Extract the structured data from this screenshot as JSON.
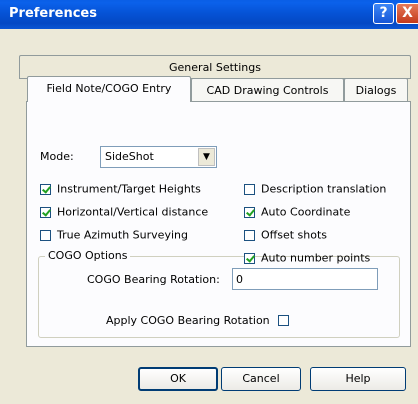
{
  "window": {
    "title": "Preferences",
    "help_glyph": "?",
    "close_glyph": "X"
  },
  "tabs": {
    "general": "General Settings",
    "field": "Field Note/COGO Entry",
    "cad": "CAD Drawing Controls",
    "dialogs": "Dialogs"
  },
  "mode": {
    "label": "Mode:",
    "value": "SideShot",
    "dropdown_glyph": "▼"
  },
  "checkboxes": {
    "instrument": {
      "label": "Instrument/Target Heights",
      "checked": true
    },
    "horizontal": {
      "label": "Horizontal/Vertical distance",
      "checked": true
    },
    "true_azimuth": {
      "label": "True Azimuth Surveying",
      "checked": false
    },
    "description": {
      "label": "Description translation",
      "checked": false
    },
    "auto_coordinate": {
      "label": "Auto Coordinate",
      "checked": true
    },
    "offset_shots": {
      "label": "Offset shots",
      "checked": false
    },
    "auto_number": {
      "label": "Auto number points",
      "checked": true
    }
  },
  "cogo": {
    "group_title": "COGO Options",
    "bearing_rotation_label": "COGO Bearing Rotation:",
    "bearing_rotation_value": "0",
    "apply_label": "Apply COGO Bearing Rotation",
    "apply_checked": false
  },
  "buttons": {
    "ok": "OK",
    "cancel": "Cancel",
    "help": "Help"
  }
}
